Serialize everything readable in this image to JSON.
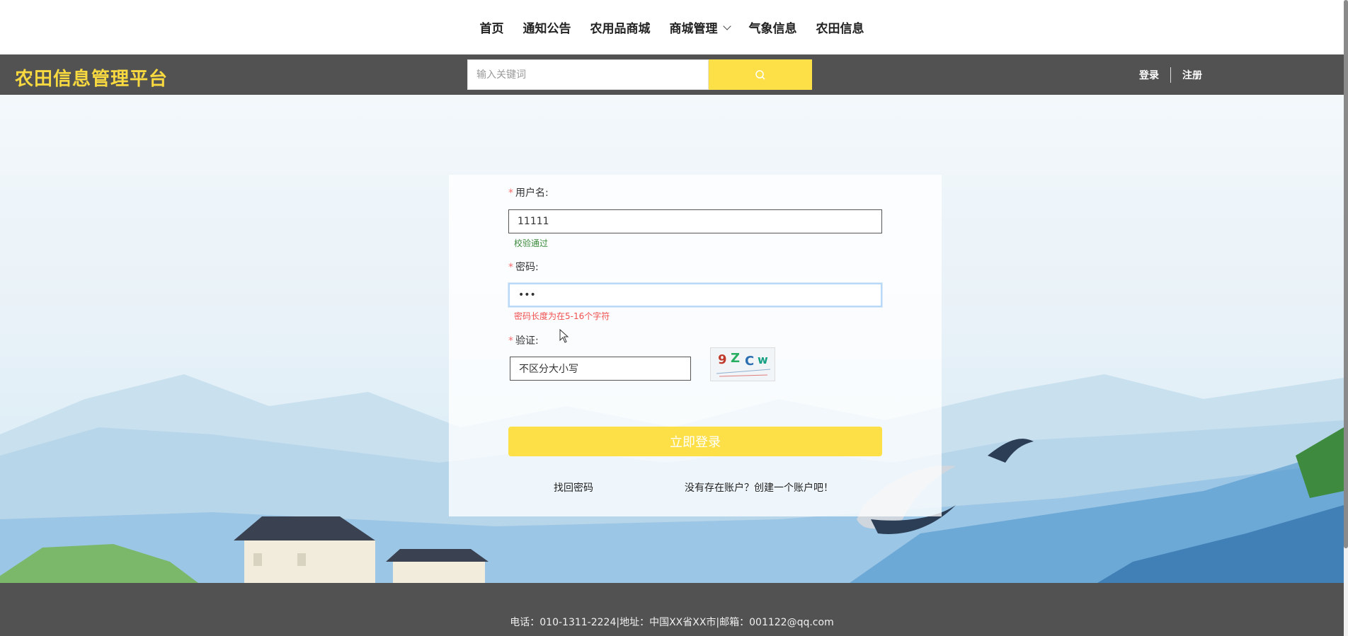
{
  "nav": {
    "items": [
      "首页",
      "通知公告",
      "农用品商城",
      "商城管理",
      "气象信息",
      "农田信息"
    ]
  },
  "header": {
    "brand": "农田信息管理平台",
    "search_placeholder": "输入关键词",
    "login": "登录",
    "register": "注册"
  },
  "form": {
    "username_label": "用户名:",
    "username_value": "11111",
    "username_msg": "校验通过",
    "password_label": "密码:",
    "password_value": "•••",
    "password_msg": "密码长度为在5-16个字符",
    "verify_label": "验证:",
    "verify_value": "不区分大小写",
    "captcha_text": "9ZCw",
    "submit": "立即登录",
    "forgot": "找回密码",
    "signup": "没有存在账户？创建一个账户吧！",
    "required_mark": "*"
  },
  "footer": {
    "text": "电话：010-1311-2224|地址：中国XX省XX市|邮箱：001122@qq.com"
  },
  "colors": {
    "accent": "#fde047",
    "brand": "#f8d940",
    "header_bg": "#525252",
    "ok": "#3c8a3c",
    "error": "#f0504f"
  },
  "icons": {
    "search": "search-icon",
    "chevron": "chevron-down-icon"
  }
}
